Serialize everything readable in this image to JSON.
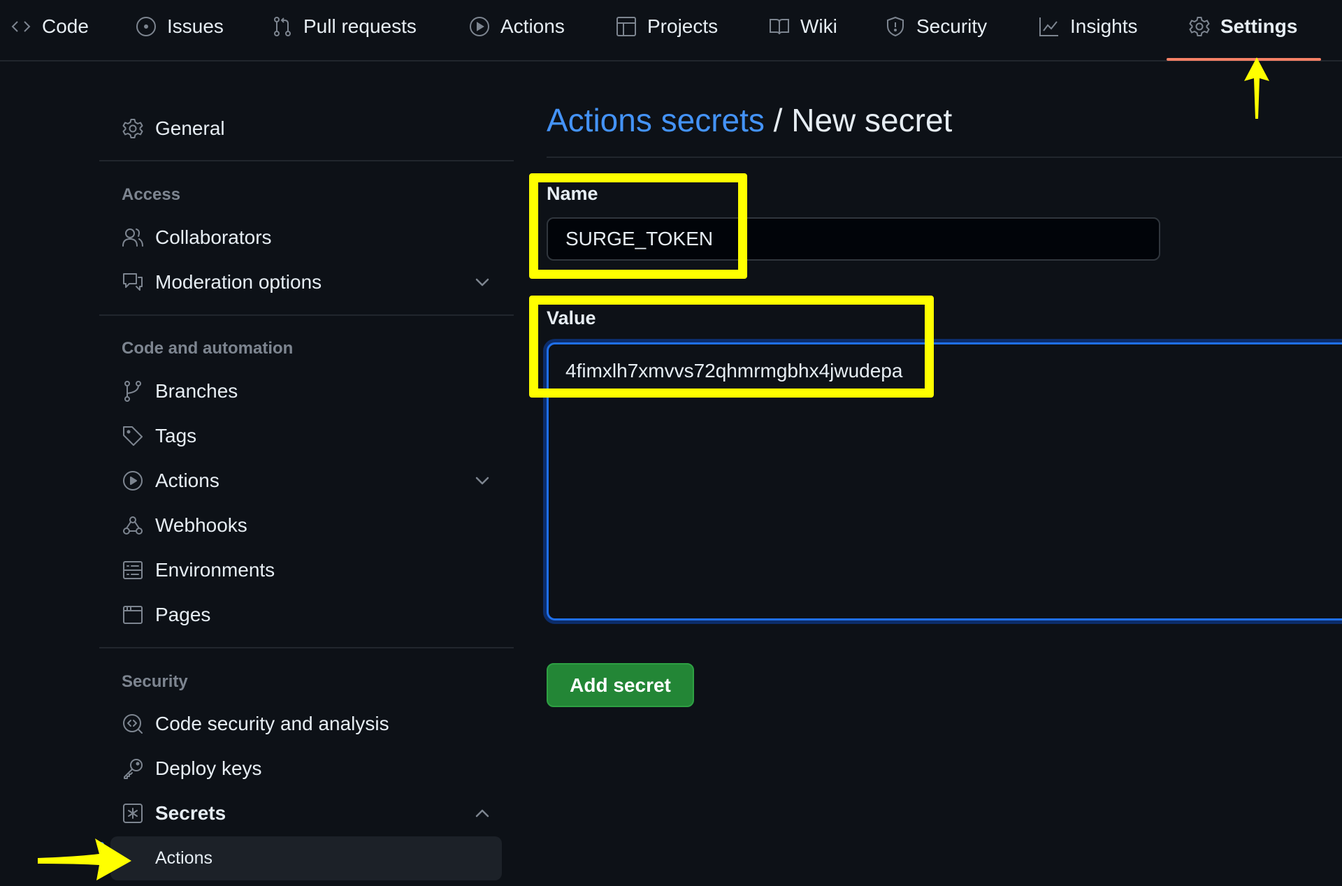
{
  "topnav": {
    "tabs": [
      {
        "label": "Code",
        "icon": "code-icon"
      },
      {
        "label": "Issues",
        "icon": "issue-opened-icon"
      },
      {
        "label": "Pull requests",
        "icon": "git-pull-request-icon"
      },
      {
        "label": "Actions",
        "icon": "play-icon"
      },
      {
        "label": "Projects",
        "icon": "table-icon"
      },
      {
        "label": "Wiki",
        "icon": "book-icon"
      },
      {
        "label": "Security",
        "icon": "shield-icon"
      },
      {
        "label": "Insights",
        "icon": "graph-icon"
      },
      {
        "label": "Settings",
        "icon": "gear-icon",
        "active": true
      }
    ],
    "active_underline_color": "#f78166"
  },
  "sidebar": {
    "general": {
      "label": "General",
      "icon": "gear-icon"
    },
    "sections": [
      {
        "heading": "Access",
        "items": [
          {
            "label": "Collaborators",
            "icon": "people-icon"
          },
          {
            "label": "Moderation options",
            "icon": "comment-discussion-icon",
            "expandable": true
          }
        ]
      },
      {
        "heading": "Code and automation",
        "items": [
          {
            "label": "Branches",
            "icon": "git-branch-icon"
          },
          {
            "label": "Tags",
            "icon": "tag-icon"
          },
          {
            "label": "Actions",
            "icon": "play-icon",
            "expandable": true
          },
          {
            "label": "Webhooks",
            "icon": "webhook-icon"
          },
          {
            "label": "Environments",
            "icon": "server-icon"
          },
          {
            "label": "Pages",
            "icon": "browser-icon"
          }
        ]
      },
      {
        "heading": "Security",
        "items": [
          {
            "label": "Code security and analysis",
            "icon": "codescan-icon"
          },
          {
            "label": "Deploy keys",
            "icon": "key-icon"
          },
          {
            "label": "Secrets",
            "icon": "key-asterisk-icon",
            "expanded": true
          },
          {
            "label": "Actions",
            "sub_item": true,
            "selected": true
          }
        ]
      }
    ]
  },
  "main": {
    "breadcrumb_link": "Actions secrets",
    "breadcrumb_separator": " / ",
    "page_title": "New secret",
    "name_label": "Name",
    "name_value": "SURGE_TOKEN",
    "value_label": "Value",
    "value_value": "4fimxlh7xmvvs72qhmrmgbhx4jwudepa",
    "submit_label": "Add secret"
  },
  "annotations": {
    "highlight_color": "#ffff00",
    "highlights": [
      "name-field",
      "value-field"
    ],
    "arrows": [
      "pointing-to-settings-tab",
      "pointing-to-secrets-actions"
    ]
  },
  "colors": {
    "background": "#0d1117",
    "link": "#4493f8",
    "primary_button": "#238636",
    "focus_border": "#1f6feb"
  }
}
